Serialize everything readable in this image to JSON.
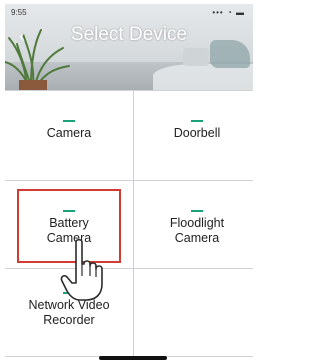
{
  "status": {
    "time": "9:55",
    "icons": "••• ◔ ▬"
  },
  "header": {
    "back_glyph": "‹",
    "title": "Select Device"
  },
  "devices": [
    {
      "label": "Camera"
    },
    {
      "label": "Doorbell"
    },
    {
      "label": "Battery\nCamera"
    },
    {
      "label": "Floodlight\nCamera"
    },
    {
      "label": "Network Video\nRecorder"
    }
  ],
  "colors": {
    "accent": "#1aa37a",
    "highlight": "#d23b32",
    "title": "#ffffff"
  },
  "icons": {
    "back": "chevron-left-icon",
    "pointer": "hand-pointer-icon"
  }
}
